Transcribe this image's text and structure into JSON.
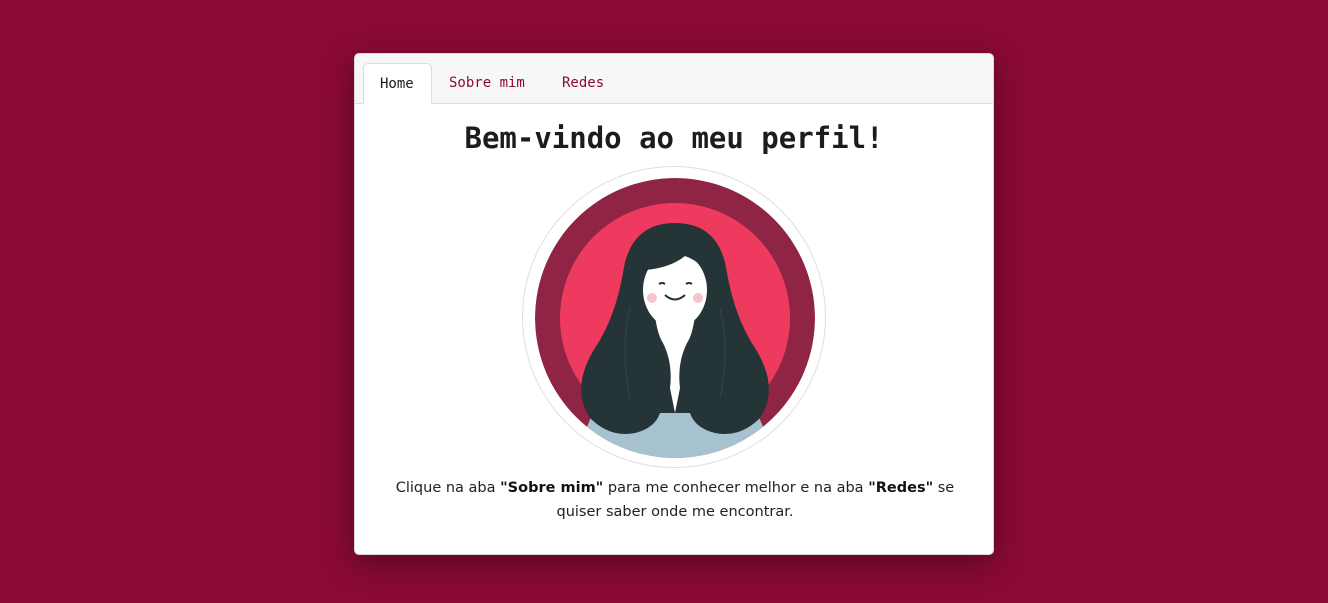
{
  "tabs": [
    {
      "label": "Home",
      "active": true
    },
    {
      "label": "Sobre mim",
      "active": false
    },
    {
      "label": "Redes",
      "active": false
    }
  ],
  "main": {
    "title": "Bem-vindo ao meu perfil!",
    "avatar_icon": "avatar-illustration",
    "caption": {
      "part1": "Clique na aba ",
      "sobre_quote": "\"Sobre mim\"",
      "part2": " para me conhecer melhor e na aba ",
      "redes_quote": "\"Redes\"",
      "part3": " se quiser saber onde me encontrar."
    }
  },
  "colors": {
    "background": "#890a33",
    "accent": "#8a0a36",
    "avatar_outer": "#8f2444",
    "avatar_inner": "#ee3a5e",
    "hair": "#253436",
    "shirt": "#a5c2ce"
  }
}
